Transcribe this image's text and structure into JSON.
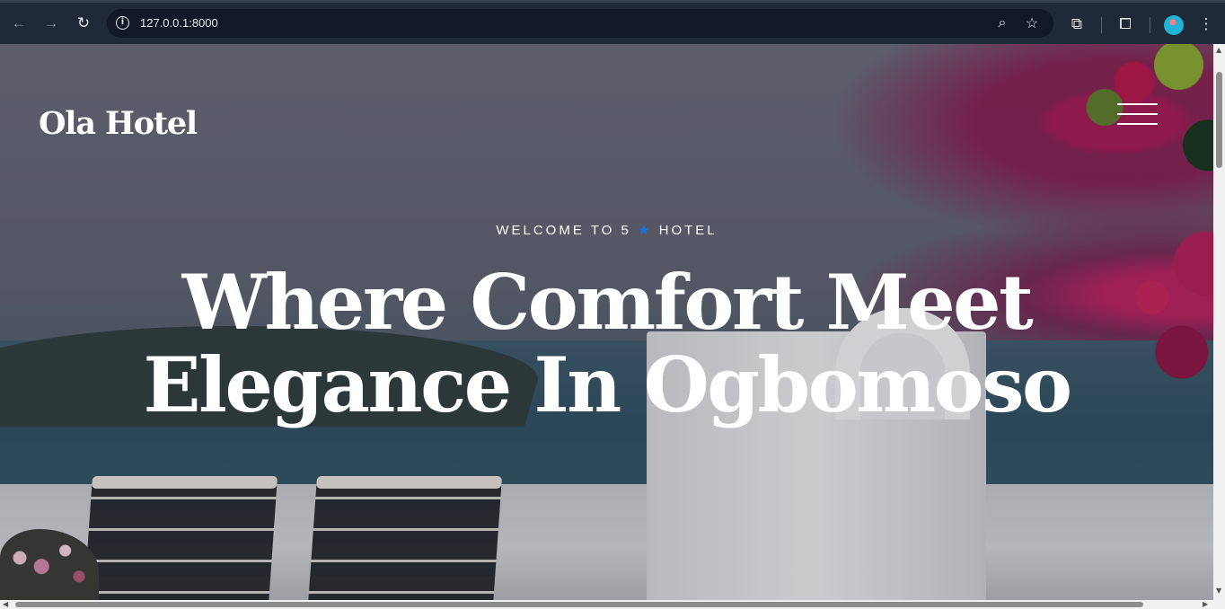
{
  "browser": {
    "url": "127.0.0.1:8000",
    "icons": {
      "back": "arrow-left-icon",
      "forward": "arrow-right-icon",
      "reload": "reload-icon",
      "site_info": "info-icon",
      "zoom": "zoom-icon",
      "bookmark": "star-icon",
      "extensions": "puzzle-icon",
      "tab_search": "tab-search-icon",
      "menu": "vertical-dots-icon"
    }
  },
  "page": {
    "brand": "Ola Hotel",
    "eyebrow_before_star": "WELCOME TO 5",
    "eyebrow_star": "★",
    "eyebrow_after_star": "HOTEL",
    "hero_line_1": "Where Comfort Meet",
    "hero_line_2": "Elegance In Ogbomoso",
    "menu_icon": "hamburger-menu-icon",
    "accent_color": "#1a73e8"
  }
}
